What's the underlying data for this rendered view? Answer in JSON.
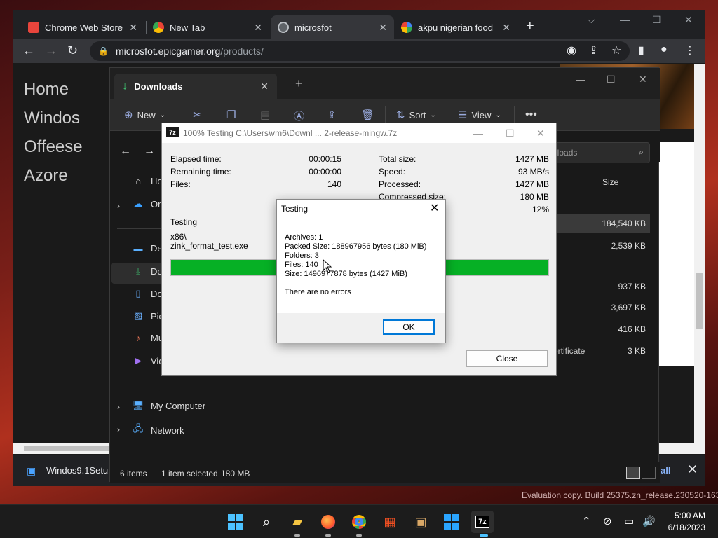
{
  "chrome": {
    "tabs": [
      {
        "label": "Chrome Web Store -",
        "icon": "chrome-web-store-icon",
        "icon_color": "#e8453c"
      },
      {
        "label": "New Tab",
        "icon": "chrome-icon",
        "icon_color": "#e8eaed"
      },
      {
        "label": "microsfot",
        "icon": "globe-icon",
        "icon_color": "#bdc1c6"
      },
      {
        "label": "akpu nigerian food -",
        "icon": "google-icon",
        "icon_color": "#4285f4"
      }
    ],
    "url_host": "microsfot.epicgamer.org",
    "url_path": "/products/"
  },
  "webpage": {
    "nav": [
      "Home",
      "Windos",
      "Offeese",
      "Azore"
    ]
  },
  "download_bar": {
    "filename": "Windos9.1Setup",
    "show_all": "all"
  },
  "explorer": {
    "tab_title": "Downloads",
    "commands": {
      "new": "New",
      "sort": "Sort",
      "view": "View"
    },
    "search_placeholder": "nloads",
    "nav_items": [
      {
        "label": "Home",
        "icon": "home-icon"
      },
      {
        "label": "OneDrive",
        "icon": "onedrive-icon"
      },
      {
        "label": "Desktop",
        "icon": "desktop-icon"
      },
      {
        "label": "Downloads",
        "icon": "download-icon"
      },
      {
        "label": "Documents",
        "icon": "documents-icon"
      },
      {
        "label": "Pictures",
        "icon": "pictures-icon"
      },
      {
        "label": "Music",
        "icon": "music-icon"
      },
      {
        "label": "Videos",
        "icon": "videos-icon"
      },
      {
        "label": "My Computer",
        "icon": "computer-icon"
      },
      {
        "label": "Network",
        "icon": "network-icon"
      }
    ],
    "size_header": "Size",
    "rows": [
      {
        "type": "",
        "size": "184,540 KB"
      },
      {
        "type": "n",
        "size": "2,539 KB"
      },
      {
        "type": "n",
        "size": "937 KB"
      },
      {
        "type": "n",
        "size": "3,697 KB"
      },
      {
        "type": "n",
        "size": "416 KB"
      },
      {
        "type": "ertificate",
        "size": "3 KB"
      }
    ],
    "status": {
      "items": "6 items",
      "selected": "1 item selected",
      "size": "180 MB"
    }
  },
  "sevenzip": {
    "title": "100% Testing C:\\Users\\vm6\\Downl ... 2-release-mingw.7z",
    "elapsed_label": "Elapsed time:",
    "elapsed": "00:00:15",
    "remaining_label": "Remaining time:",
    "remaining": "00:00:00",
    "files_label": "Files:",
    "files": "140",
    "total_label": "Total size:",
    "total": "1427 MB",
    "speed_label": "Speed:",
    "speed": "93 MB/s",
    "processed_label": "Processed:",
    "processed": "1427 MB",
    "compressed_label": "Compressed size:",
    "compressed": "180 MB",
    "ratio": "12%",
    "action": "Testing",
    "current_dir": "x86\\",
    "current_file": "zink_format_test.exe",
    "progress": 1.0,
    "close_label": "Close"
  },
  "testing_dialog": {
    "title": "Testing",
    "archives": "Archives: 1",
    "packed": "Packed Size: 188967956 bytes (180 MiB)",
    "folders": "Folders: 3",
    "files": "Files: 140",
    "size": "Size: 1496977878 bytes (1427 MiB)",
    "result": "There are no errors",
    "ok_label": "OK"
  },
  "watermark": "Evaluation copy. Build 25375.zn_release.230520-1632",
  "taskbar": {
    "time": "5:00 AM",
    "date": "6/18/2023",
    "apps": [
      "start-icon",
      "search-icon",
      "file-explorer-icon",
      "firefox-icon",
      "chrome-icon",
      "store-icon",
      "package-icon",
      "windows-logo-icon",
      "sevenzip-icon"
    ]
  }
}
